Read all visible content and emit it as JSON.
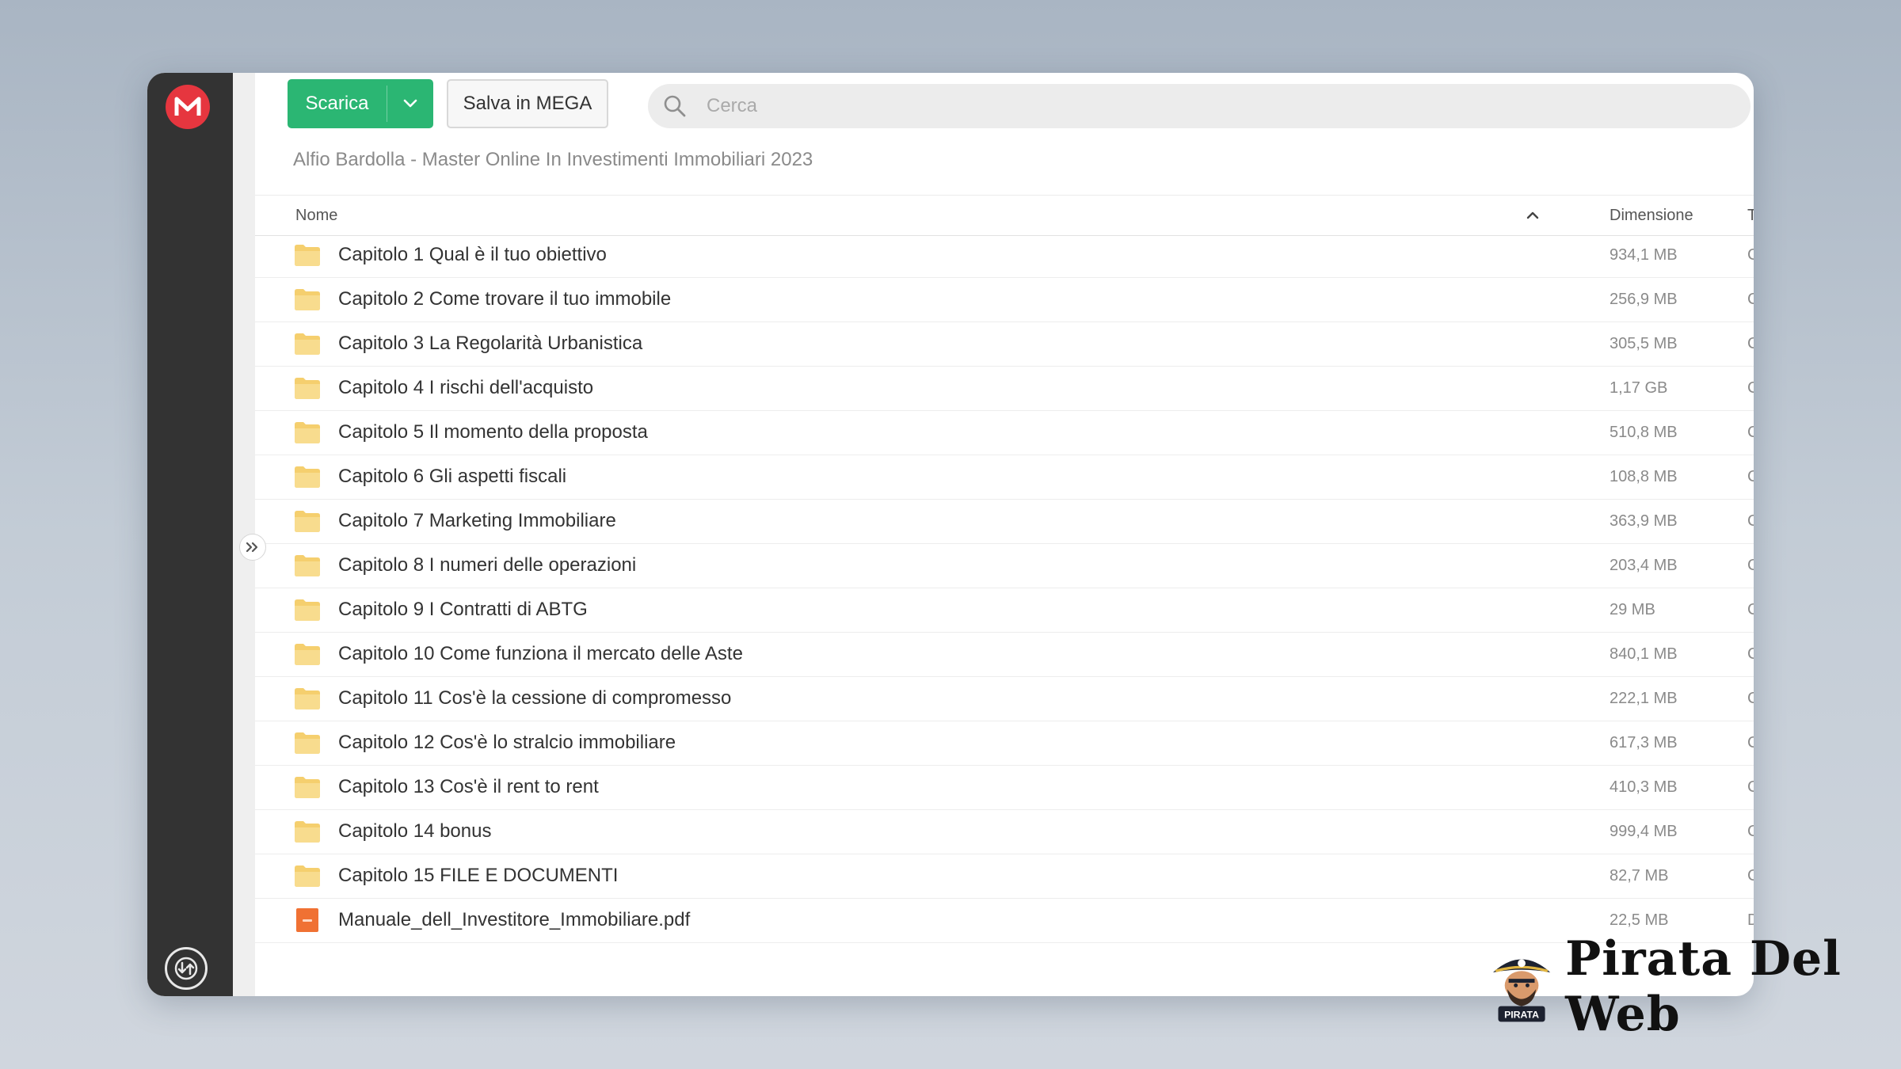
{
  "toolbar": {
    "download_label": "Scarica",
    "save_label": "Salva in MEGA"
  },
  "search": {
    "placeholder": "Cerca"
  },
  "breadcrumb": "Alfio Bardolla - Master Online In Investimenti Immobiliari 2023",
  "table": {
    "columns": {
      "name": "Nome",
      "size": "Dimensione",
      "type": "Tipo"
    },
    "rows": [
      {
        "name": "Capitolo 1 Qual è il tuo obiettivo",
        "size": "934,1 MB",
        "type": "Cartella",
        "icon": "folder-icon"
      },
      {
        "name": "Capitolo 2 Come trovare il tuo immobile",
        "size": "256,9 MB",
        "type": "Cartella",
        "icon": "folder-icon"
      },
      {
        "name": "Capitolo 3 La Regolarità Urbanistica",
        "size": "305,5 MB",
        "type": "Cartella",
        "icon": "folder-icon"
      },
      {
        "name": "Capitolo 4 I rischi dell'acquisto",
        "size": "1,17 GB",
        "type": "Cartella",
        "icon": "folder-icon"
      },
      {
        "name": "Capitolo 5 Il momento della proposta",
        "size": "510,8 MB",
        "type": "Cartella",
        "icon": "folder-icon"
      },
      {
        "name": "Capitolo 6 Gli aspetti fiscali",
        "size": "108,8 MB",
        "type": "Cartella",
        "icon": "folder-icon"
      },
      {
        "name": "Capitolo 7 Marketing Immobiliare",
        "size": "363,9 MB",
        "type": "Cartella",
        "icon": "folder-icon"
      },
      {
        "name": "Capitolo 8 I numeri delle operazioni",
        "size": "203,4 MB",
        "type": "Cartella",
        "icon": "folder-icon"
      },
      {
        "name": "Capitolo 9 I Contratti di ABTG",
        "size": "29 MB",
        "type": "Cartella",
        "icon": "folder-icon"
      },
      {
        "name": "Capitolo 10 Come funziona il mercato delle Aste",
        "size": "840,1 MB",
        "type": "Cartella",
        "icon": "folder-icon"
      },
      {
        "name": "Capitolo 11 Cos'è la cessione di compromesso",
        "size": "222,1 MB",
        "type": "Cartella",
        "icon": "folder-icon"
      },
      {
        "name": "Capitolo 12 Cos'è lo stralcio immobiliare",
        "size": "617,3 MB",
        "type": "Cartella",
        "icon": "folder-icon"
      },
      {
        "name": "Capitolo 13 Cos'è il rent to rent",
        "size": "410,3 MB",
        "type": "Cartella",
        "icon": "folder-icon"
      },
      {
        "name": "Capitolo 14 bonus",
        "size": "999,4 MB",
        "type": "Cartella",
        "icon": "folder-icon"
      },
      {
        "name": "Capitolo 15 FILE E DOCUMENTI",
        "size": "82,7 MB",
        "type": "Cartella",
        "icon": "folder-icon"
      },
      {
        "name": "Manuale_dell_Investitore_Immobiliare.pdf",
        "size": "22,5 MB",
        "type": "Documento PDF",
        "icon": "pdf-file-icon"
      }
    ]
  },
  "watermark": {
    "brand": "Pirata Del Web",
    "badge_text": "PIRATA"
  },
  "colors": {
    "accent_green": "#2bb673",
    "mega_red": "#e6363f",
    "sidebar_dark": "#333333",
    "folder_yellow": "#f5cf6e",
    "pdf_orange": "#f07133"
  }
}
